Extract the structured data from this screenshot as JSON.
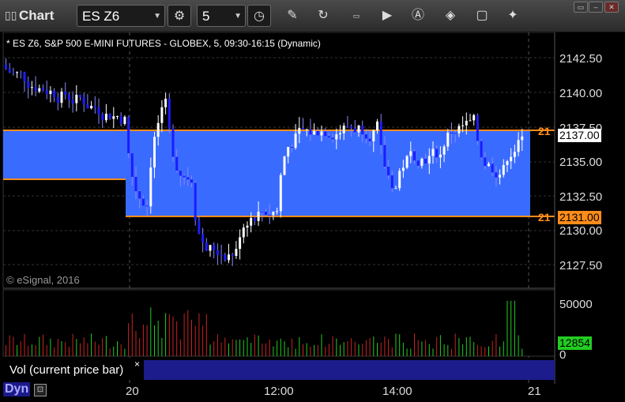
{
  "app": {
    "title": "Chart"
  },
  "toolbar": {
    "symbol": "ES Z6",
    "interval": "5",
    "icons": [
      "gear-icon",
      "clock-icon",
      "pencil-icon",
      "refresh-icon",
      "get-icon",
      "play-icon",
      "alert-icon",
      "tag-icon",
      "comment-icon",
      "twitter-icon"
    ]
  },
  "chart": {
    "symbol_line": "* ES Z6, S&P 500 E-MINI FUTURES - GLOBEX, 5, 09:30-16:15 (Dynamic)",
    "copyright": "© eSignal, 2016",
    "price_ticks": [
      "2142.50",
      "2140.00",
      "2137.50",
      "2135.00",
      "2132.50",
      "2130.00",
      "2127.50"
    ],
    "current_price": "2137.00",
    "zone_upper_label": "21",
    "zone_lower_label": "21",
    "zone_lower_price": "2131.00",
    "colors": {
      "zone": "#3a6bff",
      "zone_line": "#ff8c1a",
      "up": "#ffffff",
      "down": "#1c1cff",
      "vol_up": "#22cc22",
      "vol_down": "#cc2222"
    }
  },
  "volume": {
    "panel_label": "Vol (current price bar)",
    "close_label": "×",
    "ticks": [
      "50000",
      "0"
    ],
    "current": "12854"
  },
  "time_axis": [
    "20",
    "12:00",
    "14:00",
    "21"
  ],
  "footer": {
    "mode": "Dyn"
  }
}
